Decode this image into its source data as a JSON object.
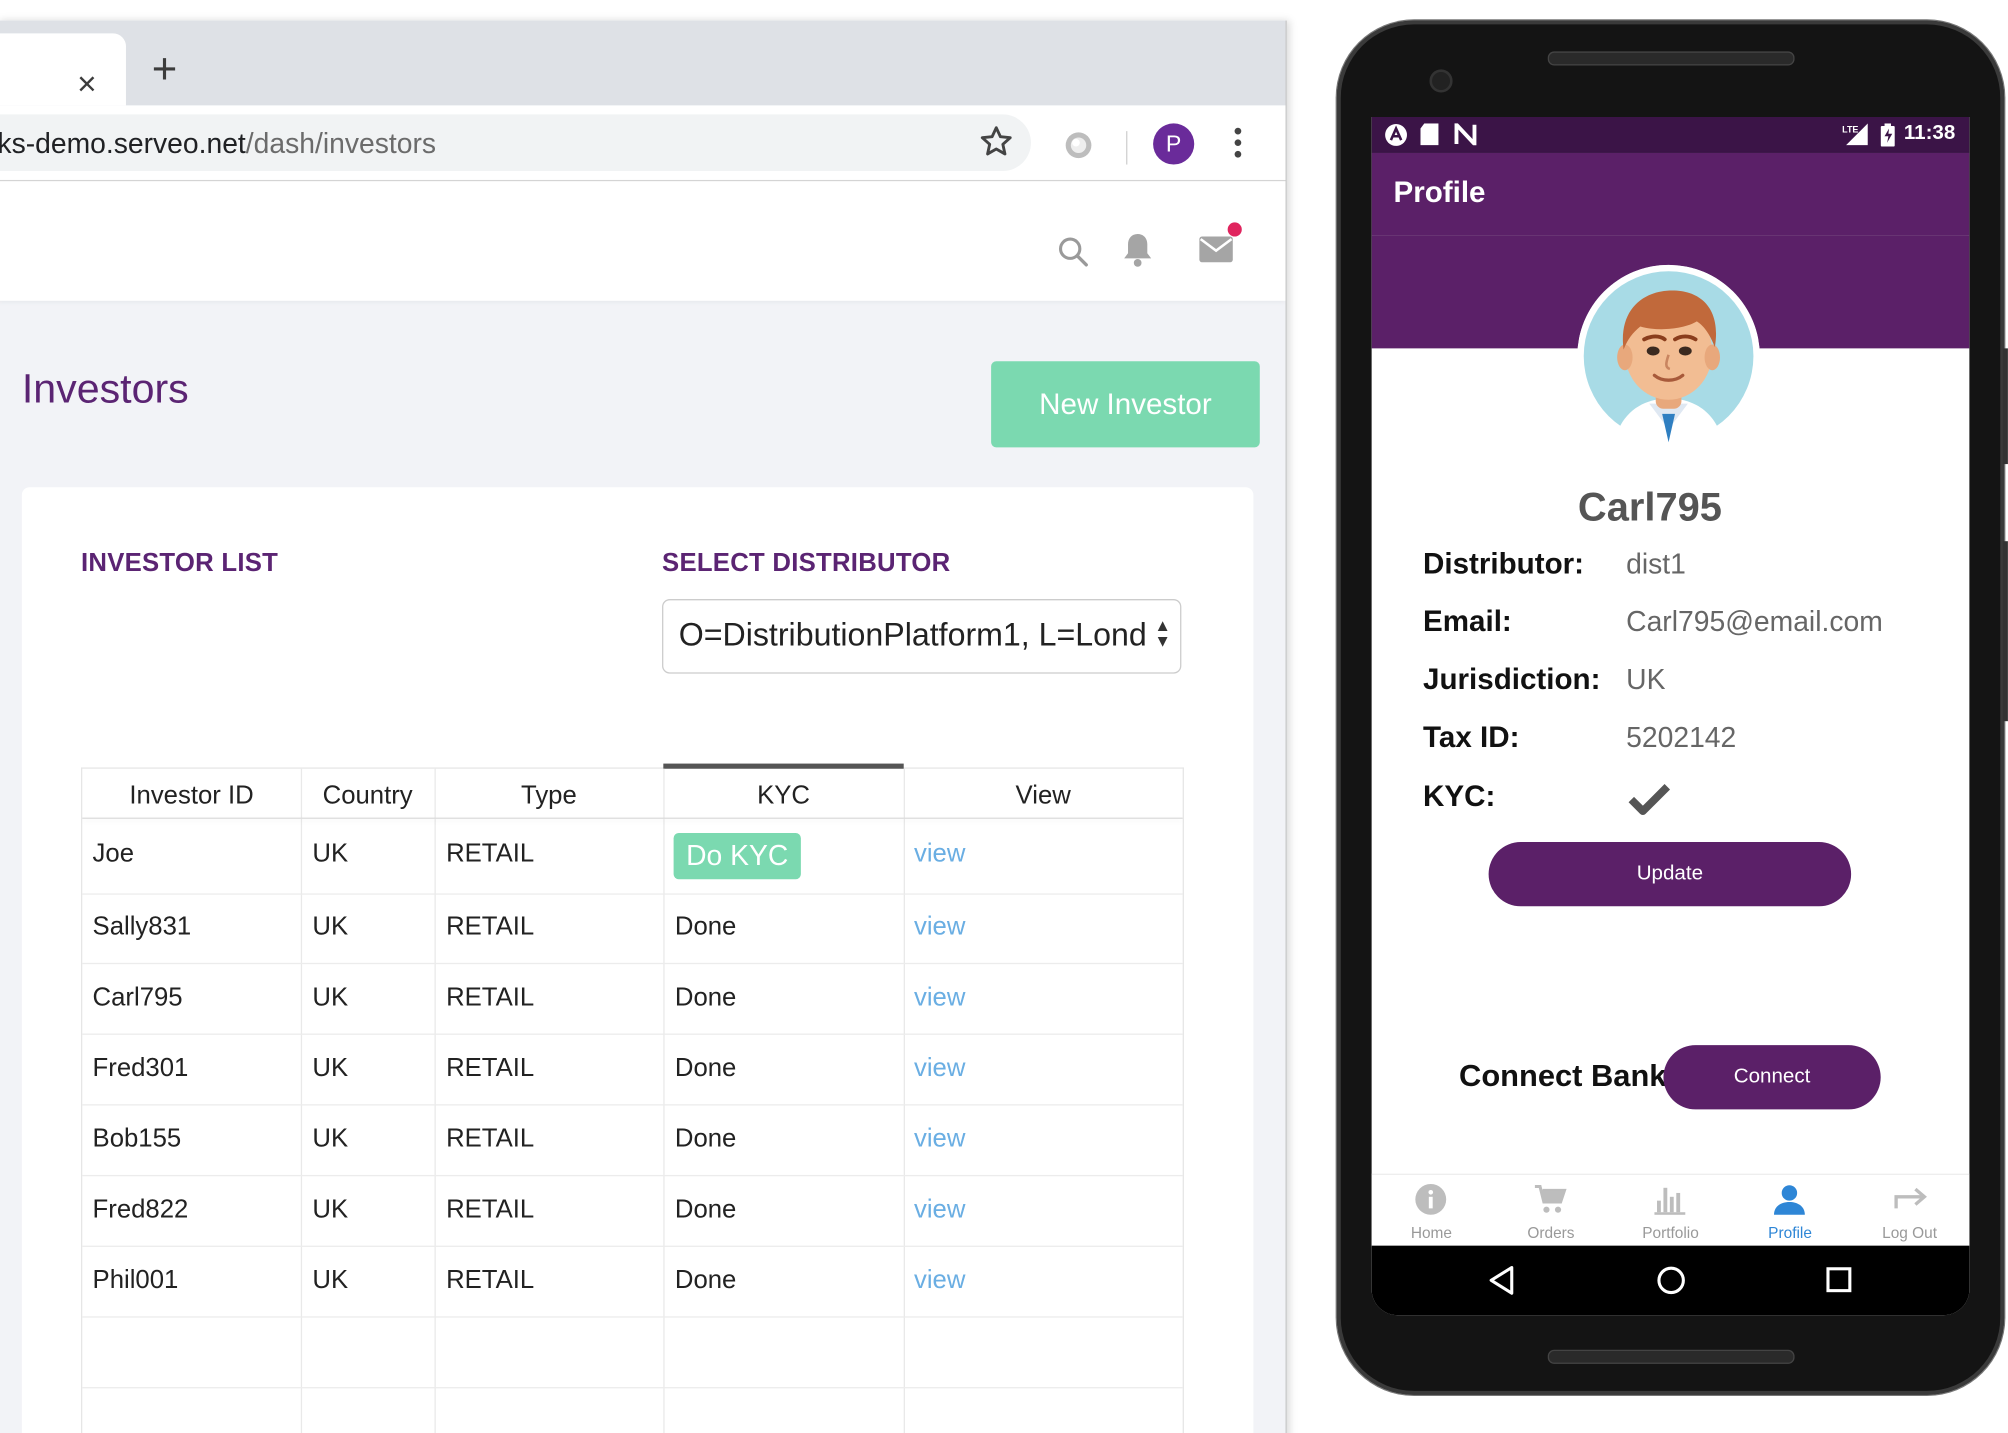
{
  "browser": {
    "tab": {
      "close_glyph": "×"
    },
    "new_tab_glyph": "+",
    "url_host": "ks-demo.serveo.net",
    "url_path": "/dash/investors",
    "profile_initial": "P"
  },
  "dashboard": {
    "title": "Investors",
    "new_investor_label": "New Investor",
    "investor_list_label": "INVESTOR LIST",
    "select_distributor_label": "SELECT DISTRIBUTOR",
    "distributor_value": "O=DistributionPlatform1, L=Lond",
    "columns": [
      "Investor ID",
      "Country",
      "Type",
      "KYC",
      "View"
    ],
    "rows": [
      {
        "id": "Joe",
        "country": "UK",
        "type": "RETAIL",
        "kyc": "Do KYC",
        "view": "view"
      },
      {
        "id": "Sally831",
        "country": "UK",
        "type": "RETAIL",
        "kyc": "Done",
        "view": "view"
      },
      {
        "id": "Carl795",
        "country": "UK",
        "type": "RETAIL",
        "kyc": "Done",
        "view": "view"
      },
      {
        "id": "Fred301",
        "country": "UK",
        "type": "RETAIL",
        "kyc": "Done",
        "view": "view"
      },
      {
        "id": "Bob155",
        "country": "UK",
        "type": "RETAIL",
        "kyc": "Done",
        "view": "view"
      },
      {
        "id": "Fred822",
        "country": "UK",
        "type": "RETAIL",
        "kyc": "Done",
        "view": "view"
      },
      {
        "id": "Phil001",
        "country": "UK",
        "type": "RETAIL",
        "kyc": "Done",
        "view": "view"
      }
    ]
  },
  "phone": {
    "time": "11:38",
    "appbar_title": "Profile",
    "username": "Carl795",
    "fields": [
      {
        "label": "Distributor:",
        "value": "dist1"
      },
      {
        "label": "Email:",
        "value": "Carl795@email.com"
      },
      {
        "label": "Jurisdiction:",
        "value": "UK"
      },
      {
        "label": "Tax ID:",
        "value": "5202142"
      }
    ],
    "kyc_label": "KYC:",
    "update_label": "Update",
    "connect_bank_label": "Connect Bank",
    "connect_label": "Connect",
    "nav": [
      {
        "label": "Home",
        "icon": "info-icon",
        "active": false
      },
      {
        "label": "Orders",
        "icon": "cart-icon",
        "active": false
      },
      {
        "label": "Portfolio",
        "icon": "bar-chart-icon",
        "active": false
      },
      {
        "label": "Profile",
        "icon": "person-icon",
        "active": true
      },
      {
        "label": "Log Out",
        "icon": "logout-arrow-icon",
        "active": false
      }
    ]
  },
  "colors": {
    "brand_purple": "#5b2068",
    "accent_green": "#7bd9b0",
    "link_blue": "#6aaee3",
    "active_nav_blue": "#2e86d6"
  }
}
